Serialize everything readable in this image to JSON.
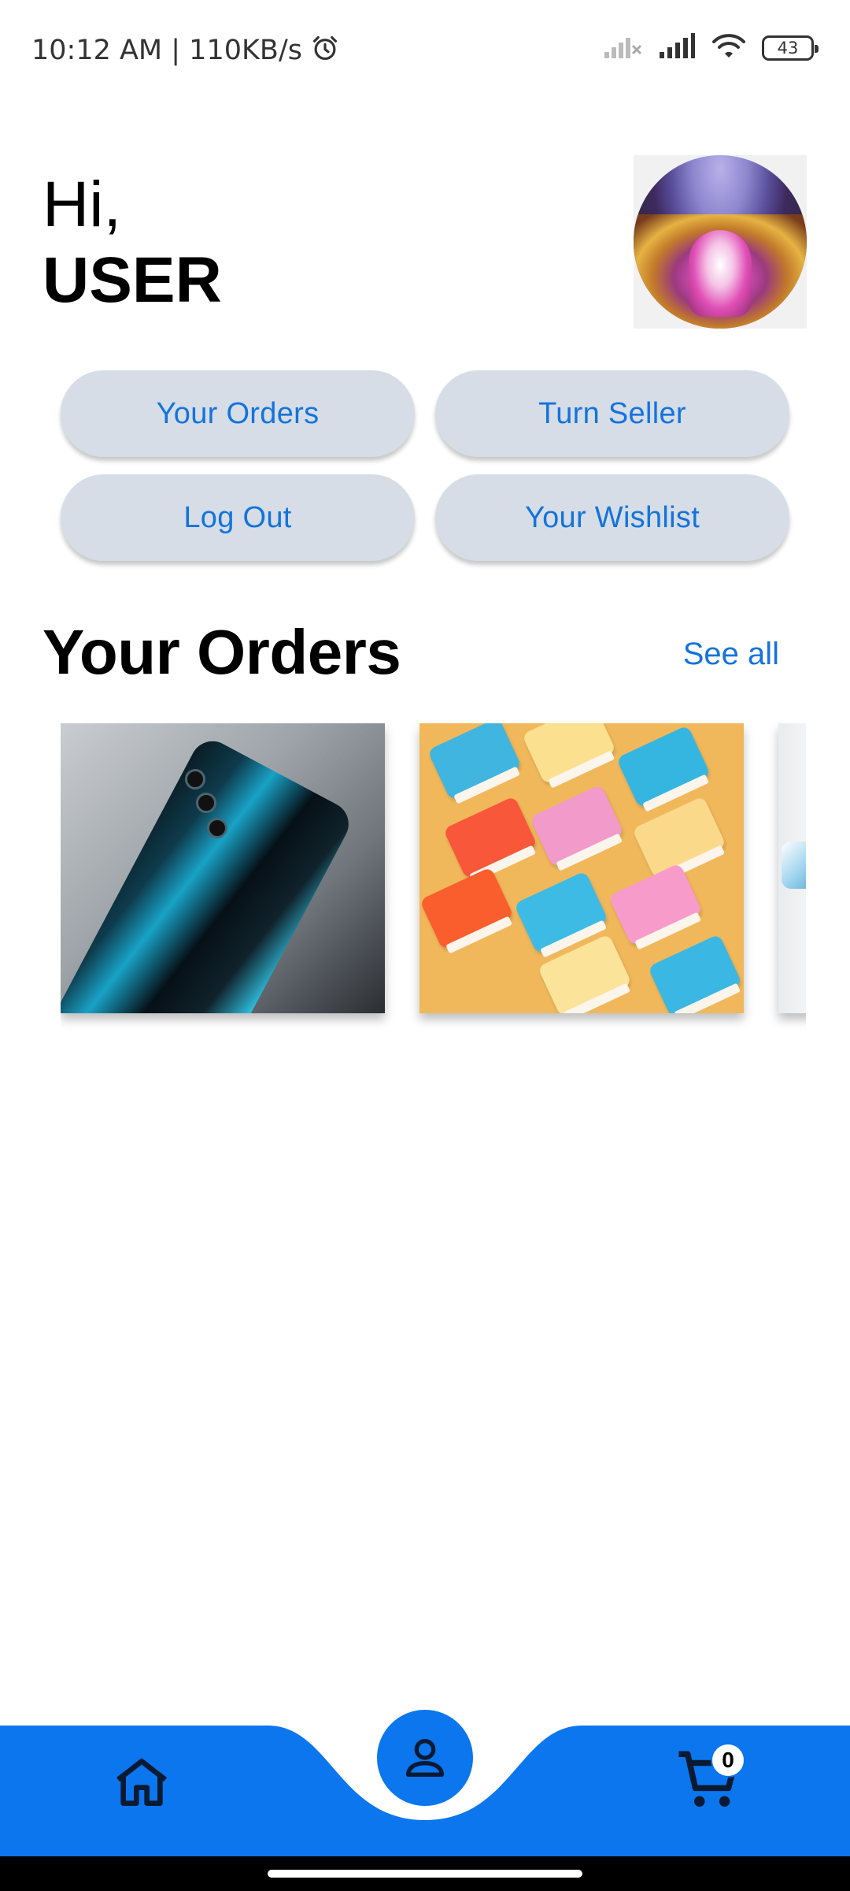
{
  "status_bar": {
    "time_speed": "10:12 AM | 110KB/s",
    "battery_level": "43",
    "icons": [
      "alarm-icon",
      "signal-off-icon",
      "signal-icon",
      "wifi-icon",
      "battery-icon"
    ]
  },
  "greeting": {
    "hi": "Hi,",
    "user": "USER"
  },
  "actions": {
    "your_orders": "Your Orders",
    "turn_seller": "Turn Seller",
    "log_out": "Log Out",
    "your_wishlist": "Your Wishlist"
  },
  "orders_section": {
    "title": "Your Orders",
    "see_all": "See all"
  },
  "bottom_nav": {
    "items": [
      "home-icon",
      "profile-icon",
      "cart-icon"
    ],
    "cart_count": "0"
  },
  "colors": {
    "accent": "#0b76ee",
    "link_blue": "#1473dc",
    "pill_bg": "#d6dde6"
  }
}
